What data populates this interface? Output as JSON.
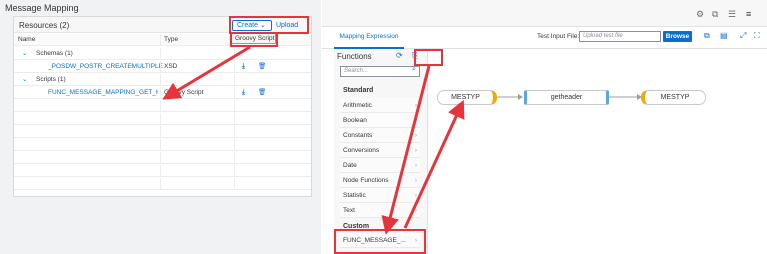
{
  "left": {
    "title": "Message Mapping",
    "resources_title": "Resources (2)",
    "create_label": "Create ⌄",
    "upload_label": "Upload",
    "dropdown_option": "Groovy Script",
    "columns": [
      "Name",
      "Type"
    ],
    "groups": [
      {
        "label": "Schemas (1)",
        "item": "_POSDW_POSTR_CREATEMULTIPLE",
        "type": "XSD"
      },
      {
        "label": "Scripts (1)",
        "item": "FUNC_MESSAGE_MAPPING_GET_HE",
        "type": "Groovy Script"
      }
    ]
  },
  "right": {
    "tab": "Mapping Expression",
    "test_input_label": "Test Input File:",
    "test_input_placeholder": "Upload test file",
    "browse_label": "Browse",
    "functions_label": "Functions",
    "search_placeholder": "Search...",
    "standard_header": "Standard",
    "standard_items": [
      "Arithmetic",
      "Boolean",
      "Constants",
      "Conversions",
      "Date",
      "Node Functions",
      "Statistic",
      "Text"
    ],
    "custom_header": "Custom",
    "custom_items": [
      "FUNC_MESSAGE_..."
    ],
    "nodes": {
      "source": "MESTYP",
      "function": "getheader",
      "target": "MESTYP"
    }
  },
  "colors": {
    "accent": "#0a6ed1",
    "arrow": "#e5343a",
    "source_port": "#f0ab00",
    "function_port": "#5ba7e0"
  }
}
